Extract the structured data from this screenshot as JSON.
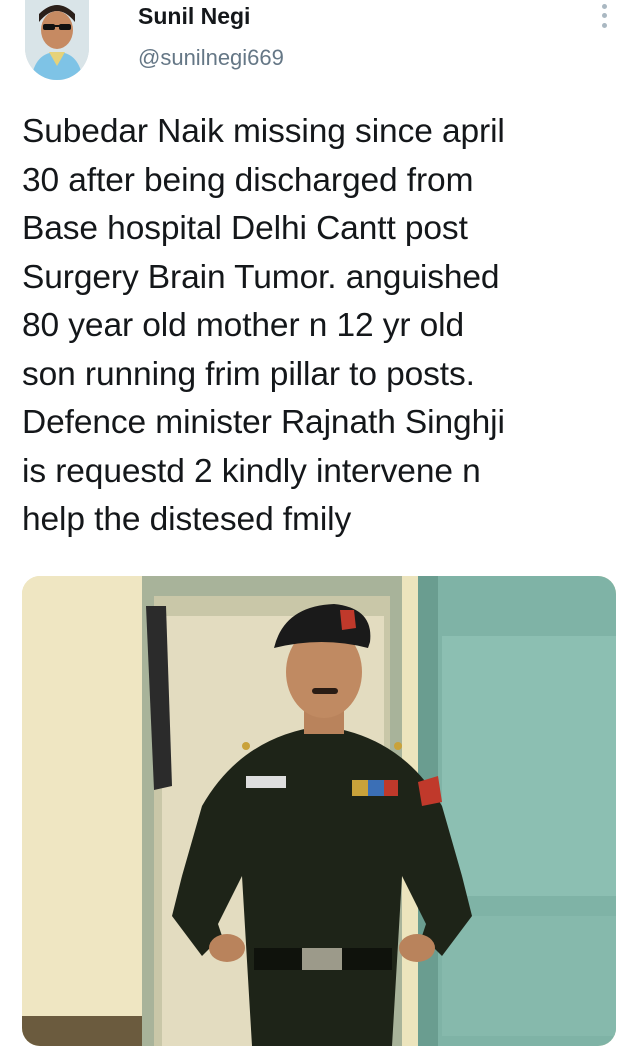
{
  "user": {
    "display_name": "Sunil Negi",
    "handle": "@sunilnegi669",
    "avatar_icon": "profile-photo"
  },
  "menu": {
    "icon": "more-vertical-icon"
  },
  "tweet": {
    "text": "Subedar Naik missing since april\n30 after being discharged from\nBase hospital Delhi Cantt post\nSurgery Brain Tumor. anguished\n80 year old mother n 12 yr old\nson running frim pillar to posts.\nDefence minister Rajnath Singhji\nis requestd 2 kindly intervene n\nhelp the distesed fmily"
  },
  "media": {
    "kind": "photo",
    "colors": {
      "wall": "#ece4bd",
      "door": "#7fb3a6",
      "uniform": "#1e2418",
      "beret": "#1a1a1a"
    }
  }
}
